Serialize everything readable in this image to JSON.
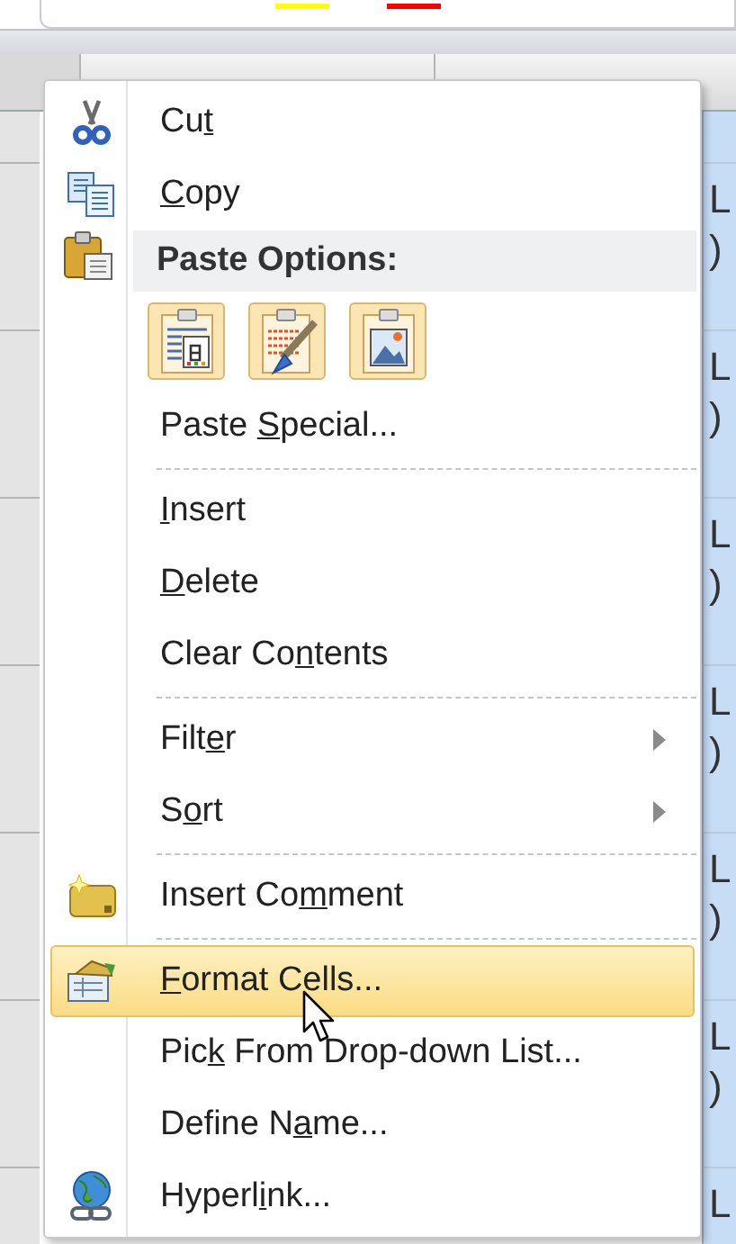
{
  "toolbar": {
    "color_bars": [
      {
        "color": "#ffff00"
      },
      {
        "color": "#ff0000"
      }
    ]
  },
  "sheet": {
    "column_b_cells": [
      {
        "lines": [
          "L",
          ")"
        ]
      },
      {
        "lines": [
          "L",
          ")"
        ]
      },
      {
        "lines": [
          "L",
          ")"
        ]
      },
      {
        "lines": [
          "L",
          ")"
        ]
      },
      {
        "lines": [
          "L",
          ")"
        ]
      },
      {
        "lines": [
          "L",
          ")"
        ]
      },
      {
        "lines": [
          "L"
        ]
      }
    ]
  },
  "context_menu": {
    "items": [
      {
        "kind": "item",
        "text": {
          "before": "Cu",
          "key": "t"
        },
        "submenu": false,
        "selected": false
      },
      {
        "kind": "item",
        "text": {
          "key": "C",
          "after": "opy"
        },
        "submenu": false,
        "selected": false
      },
      {
        "kind": "header",
        "text": "Paste Options:"
      },
      {
        "kind": "paste-options",
        "buttons": [
          {
            "kind": "values"
          },
          {
            "kind": "formatting"
          },
          {
            "kind": "picture"
          }
        ]
      },
      {
        "kind": "item",
        "text": {
          "before": "Paste ",
          "key": "S",
          "after": "pecial..."
        },
        "submenu": false,
        "selected": false
      },
      {
        "kind": "separator"
      },
      {
        "kind": "item",
        "text": {
          "key": "I",
          "after": "nsert"
        },
        "submenu": false,
        "selected": false
      },
      {
        "kind": "item",
        "text": {
          "key": "D",
          "after": "elete"
        },
        "submenu": false,
        "selected": false
      },
      {
        "kind": "item",
        "text": {
          "before": "Clear Co",
          "key": "n",
          "after": "tents"
        },
        "submenu": false,
        "selected": false
      },
      {
        "kind": "separator"
      },
      {
        "kind": "item",
        "text": {
          "before": "Filt",
          "key": "e",
          "after": "r"
        },
        "submenu": true,
        "selected": false
      },
      {
        "kind": "item",
        "text": {
          "before": "S",
          "key": "o",
          "after": "rt"
        },
        "submenu": true,
        "selected": false
      },
      {
        "kind": "separator"
      },
      {
        "kind": "item",
        "text": {
          "before": "Insert Co",
          "key": "m",
          "after": "ment"
        },
        "submenu": false,
        "selected": false
      },
      {
        "kind": "separator"
      },
      {
        "kind": "item",
        "text": {
          "key": "F",
          "after": "ormat Cells..."
        },
        "submenu": false,
        "selected": true
      },
      {
        "kind": "item",
        "text": {
          "before": "Pic",
          "key": "k",
          "after": " From Drop-down List..."
        },
        "submenu": false,
        "selected": false
      },
      {
        "kind": "item",
        "text": {
          "before": "Define N",
          "key": "a",
          "after": "me..."
        },
        "submenu": false,
        "selected": false
      },
      {
        "kind": "item",
        "text": {
          "before": "Hyperl",
          "key": "i",
          "after": "nk..."
        },
        "submenu": false,
        "selected": false
      }
    ]
  }
}
